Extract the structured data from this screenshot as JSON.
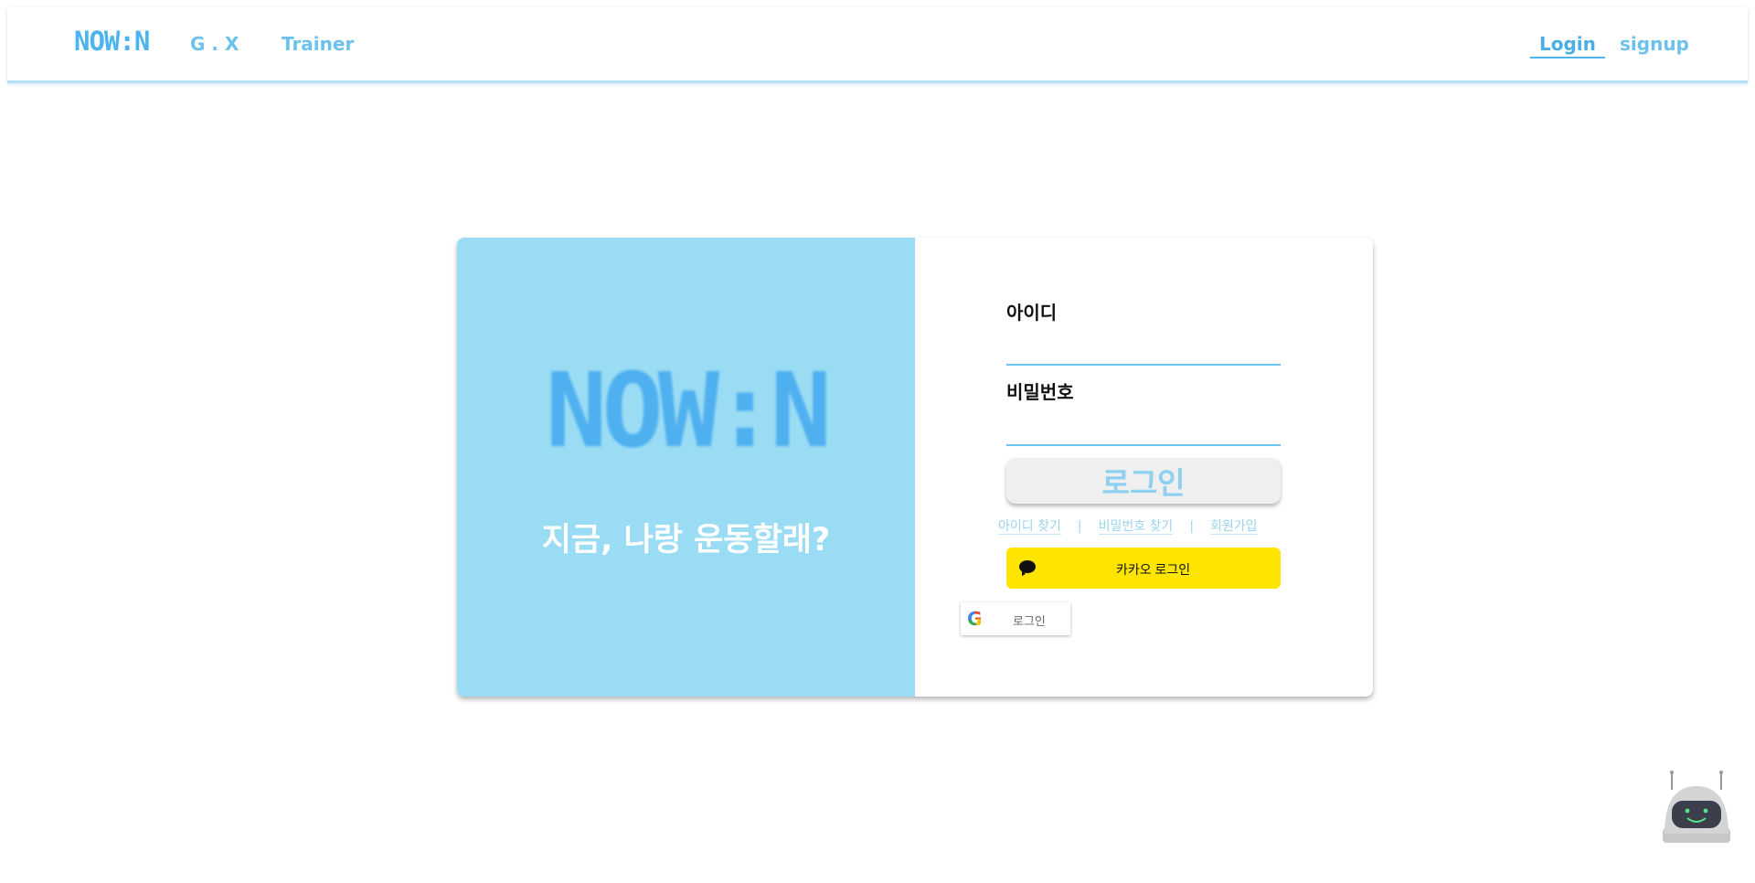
{
  "nav": {
    "logo": "NOW:N",
    "gx": "G . X",
    "trainer": "Trainer",
    "login": "Login",
    "signup": "signup"
  },
  "card": {
    "brand": "NOW:N",
    "tagline": "지금, 나랑 운동할래?",
    "id_label": "아이디",
    "pw_label": "비밀번호",
    "login_button": "로그인",
    "links": {
      "find_id": "아이디 찾기",
      "find_pw": "비밀번호 찾기",
      "join": "회원가입",
      "separator": "|"
    },
    "kakao_button": "카카오 로그인",
    "google_button": "로그인"
  },
  "colors": {
    "accent": "#4cb4ee",
    "panel": "#9adcf4",
    "kakao": "#fee500",
    "link": "#9ad3ee"
  },
  "icons": {
    "kakao": "kakao-chat-bubble-icon",
    "google": "google-g-icon",
    "chatbot": "robot-chatbot-icon"
  }
}
